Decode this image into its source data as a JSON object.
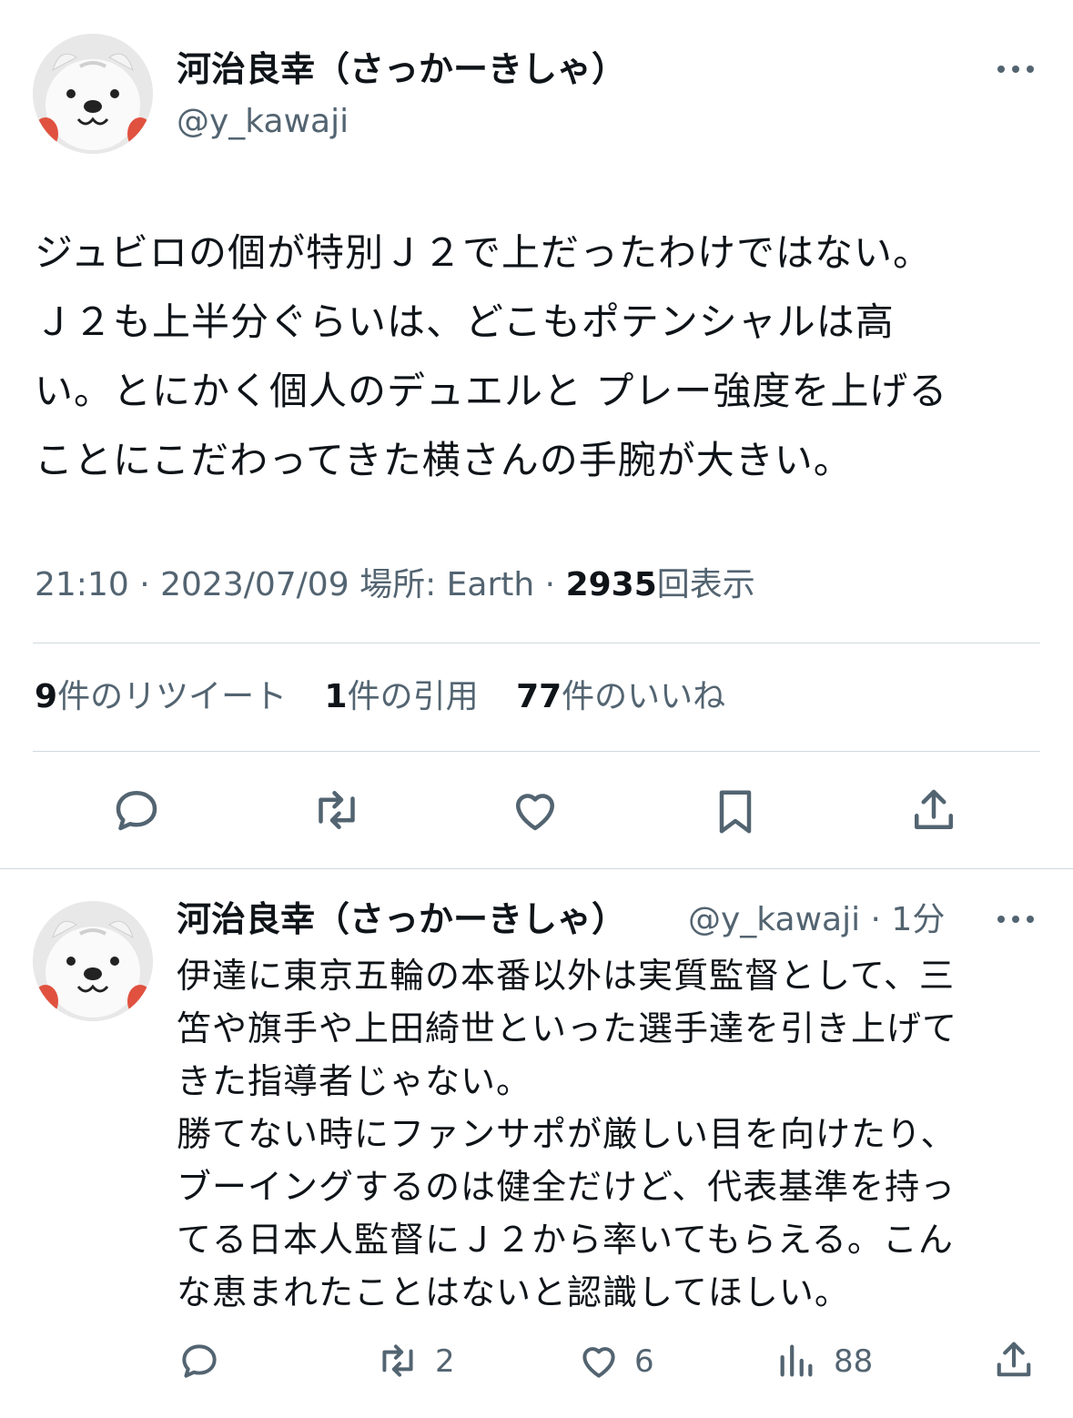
{
  "main_tweet": {
    "author_name": "河治良幸（さっかーきしゃ）",
    "author_handle": "@y_kawaji",
    "text": "ジュビロの個が特別Ｊ２で上だったわけではない。\nＪ２も上半分ぐらいは、どこもポテンシャルは高\nい。とにかく個人のデュエルと プレー強度を上げる\nことにこだわってきた横さんの手腕が大きい。",
    "time": "21:10",
    "date": "2023/07/09",
    "location_label": "場所:",
    "location": "Earth",
    "views_count": "2935",
    "views_label": "回表示",
    "separator": "·",
    "retweets_count": "9",
    "retweets_label": "件のリツイート",
    "quotes_count": "1",
    "quotes_label": "件の引用",
    "likes_count": "77",
    "likes_label": "件のいいね",
    "actions": [
      "reply-icon",
      "retweet-icon",
      "like-icon",
      "bookmark-icon",
      "share-icon"
    ]
  },
  "reply_tweet": {
    "author_name": "河治良幸（さっかーきしゃ）",
    "author_handle": "@y_kawaji",
    "time_ago": "· 1分",
    "text": "伊達に東京五輪の本番以外は実質監督として、三\n笘や旗手や上田綺世といった選手達を引き上げて\nきた指導者じゃない。\n勝てない時にファンサポが厳しい目を向けたり、\nブーイングするのは健全だけど、代表基準を持っ\nてる日本人監督にＪ２から率いてもらえる。こん\nな恵まれたことはないと認識してほしい。",
    "reply_count": "",
    "retweet_count": "2",
    "like_count": "6",
    "views_count": "88",
    "actions": [
      "reply-icon",
      "retweet-icon",
      "like-icon",
      "views-icon",
      "share-icon"
    ]
  },
  "colors": {
    "text": "#0f1419",
    "secondary": "#536471",
    "divider": "#cfd9de",
    "avatar_accent": "#e0523f"
  }
}
